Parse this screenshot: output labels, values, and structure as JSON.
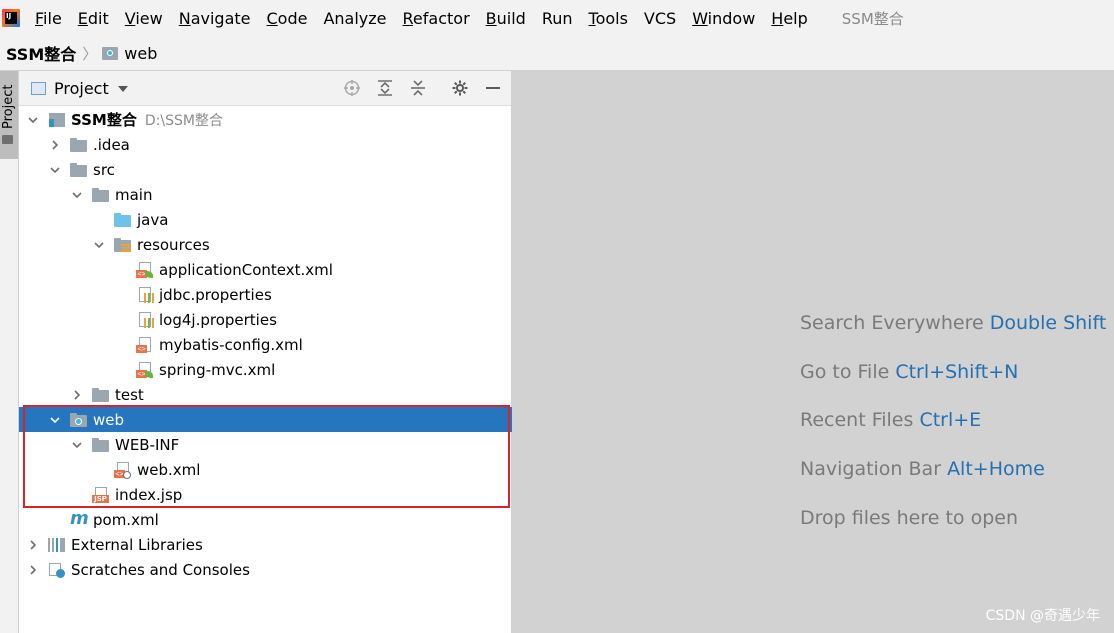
{
  "menubar": {
    "items": [
      {
        "mn": "F",
        "rest": "ile"
      },
      {
        "mn": "E",
        "rest": "dit"
      },
      {
        "mn": "V",
        "rest": "iew"
      },
      {
        "mn": "N",
        "rest": "avigate"
      },
      {
        "mn": "C",
        "rest": "ode"
      },
      {
        "mn": "",
        "rest": "Analyze"
      },
      {
        "mn": "R",
        "rest": "efactor"
      },
      {
        "mn": "B",
        "rest": "uild"
      },
      {
        "mn": "",
        "rest": "Run"
      },
      {
        "mn": "T",
        "rest": "ools"
      },
      {
        "mn": "",
        "rest": "VCS"
      },
      {
        "mn": "W",
        "rest": "indow"
      },
      {
        "mn": "H",
        "rest": "elp"
      }
    ],
    "window_title": "SSM整合"
  },
  "breadcrumb": {
    "root": "SSM整合",
    "child": "web"
  },
  "side": {
    "tab_label": "Project"
  },
  "panel": {
    "title": "Project"
  },
  "tree": [
    {
      "label": "SSM整合",
      "hint": "D:\\SSM整合",
      "depth": 0,
      "expand": "open",
      "icon": "root",
      "bold": true
    },
    {
      "label": ".idea",
      "depth": 1,
      "expand": "closed",
      "icon": "folder"
    },
    {
      "label": "src",
      "depth": 1,
      "expand": "open",
      "icon": "folder"
    },
    {
      "label": "main",
      "depth": 2,
      "expand": "open",
      "icon": "folder"
    },
    {
      "label": "java",
      "depth": 3,
      "expand": "none",
      "icon": "source-folder"
    },
    {
      "label": "resources",
      "depth": 3,
      "expand": "open",
      "icon": "resources-folder"
    },
    {
      "label": "applicationContext.xml",
      "depth": 4,
      "expand": "none",
      "icon": "spring-xml"
    },
    {
      "label": "jdbc.properties",
      "depth": 4,
      "expand": "none",
      "icon": "properties"
    },
    {
      "label": "log4j.properties",
      "depth": 4,
      "expand": "none",
      "icon": "properties"
    },
    {
      "label": "mybatis-config.xml",
      "depth": 4,
      "expand": "none",
      "icon": "xml"
    },
    {
      "label": "spring-mvc.xml",
      "depth": 4,
      "expand": "none",
      "icon": "spring-xml"
    },
    {
      "label": "test",
      "depth": 2,
      "expand": "closed",
      "icon": "folder"
    },
    {
      "label": "web",
      "depth": 1,
      "expand": "open",
      "icon": "web-folder",
      "selected": true
    },
    {
      "label": "WEB-INF",
      "depth": 2,
      "expand": "open",
      "icon": "folder"
    },
    {
      "label": "web.xml",
      "depth": 3,
      "expand": "none",
      "icon": "web-xml"
    },
    {
      "label": "index.jsp",
      "depth": 2,
      "expand": "none",
      "icon": "jsp"
    },
    {
      "label": "pom.xml",
      "depth": 1,
      "expand": "none",
      "icon": "maven"
    },
    {
      "label": "External Libraries",
      "depth": 0,
      "expand": "closed",
      "icon": "libraries"
    },
    {
      "label": "Scratches and Consoles",
      "depth": 0,
      "expand": "closed",
      "icon": "scratches"
    }
  ],
  "editor": {
    "hints": [
      {
        "text": "Search Everywhere",
        "key": "Double Shift"
      },
      {
        "text": "Go to File",
        "key": "Ctrl+Shift+N"
      },
      {
        "text": "Recent Files",
        "key": "Ctrl+E"
      },
      {
        "text": "Navigation Bar",
        "key": "Alt+Home"
      },
      {
        "text": "Drop files here to open",
        "key": ""
      }
    ],
    "watermark": "CSDN @奇遇少年"
  },
  "colors": {
    "selection": "#2675bf",
    "highlight_border": "#d6242c",
    "key_text": "#2470b3"
  }
}
